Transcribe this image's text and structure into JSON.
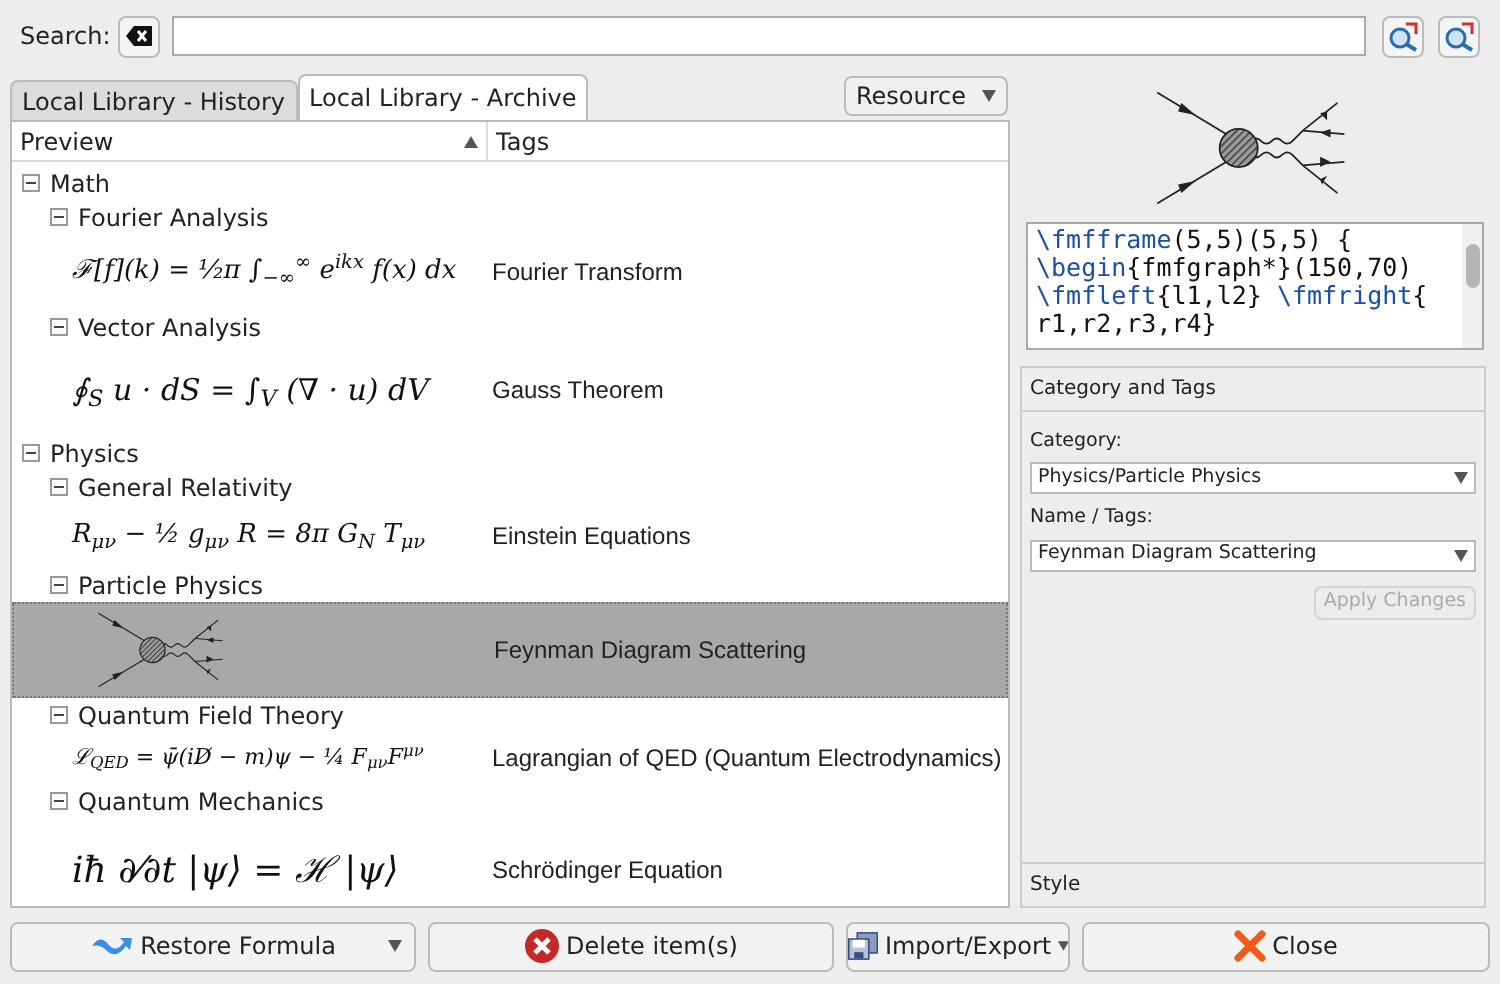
{
  "search": {
    "label": "Search:"
  },
  "tabs": [
    {
      "label": "Local Library - History",
      "selected": false
    },
    {
      "label": "Local Library - Archive",
      "selected": true
    }
  ],
  "resource_button": "Resource",
  "table": {
    "columns": [
      {
        "label": "Preview",
        "sorted": true
      },
      {
        "label": "Tags",
        "sorted": false
      }
    ],
    "tree": [
      {
        "label": "Math",
        "expanded": true,
        "children": [
          {
            "label": "Fourier Analysis",
            "expanded": true,
            "children": [
              {
                "kind": "formula",
                "formula": "ℱ[f](k) = ¹⁄₂π ∫$_{−∞}$$^{∞}$ e$^{ikx}$ f(x) dx",
                "tags": "Fourier Transform",
                "selected": false
              }
            ]
          },
          {
            "label": "Vector Analysis",
            "expanded": true,
            "children": [
              {
                "kind": "formula",
                "formula": "∮$_{S}$ u · dS = ∫$_{V}$ (∇ · u) dV",
                "tags": "Gauss Theorem",
                "selected": false
              }
            ]
          }
        ]
      },
      {
        "label": "Physics",
        "expanded": true,
        "children": [
          {
            "label": "General Relativity",
            "expanded": true,
            "children": [
              {
                "kind": "formula",
                "formula": "R$_{μν}$ − ½ g$_{μν}$ R = 8π G$_{N}$ T$_{μν}$",
                "tags": "Einstein Equations",
                "selected": false
              }
            ]
          },
          {
            "label": "Particle Physics",
            "expanded": true,
            "children": [
              {
                "kind": "diagram",
                "tags": "Feynman Diagram Scattering",
                "selected": true
              }
            ]
          },
          {
            "label": "Quantum Field Theory",
            "expanded": true,
            "children": [
              {
                "kind": "formula",
                "formula": "ℒ$_{QED}$ = ψ̄(iD̸ − m)ψ − ¼ F$_{μν}$F$^{μν}$",
                "tags": "Lagrangian of QED (Quantum Electrodynamics)",
                "selected": false
              }
            ]
          },
          {
            "label": "Quantum Mechanics",
            "expanded": true,
            "children": [
              {
                "kind": "formula",
                "formula": "iħ ∂⁄∂t |ψ⟩ = ℋ |ψ⟩",
                "tags": "Schrödinger Equation",
                "selected": false
              }
            ]
          }
        ]
      }
    ]
  },
  "preview": {
    "code": [
      [
        {
          "kind": "command",
          "text": "\\fmfframe"
        },
        {
          "kind": "plain",
          "text": "(5,5)(5,5) {"
        }
      ],
      [
        {
          "kind": "command",
          "text": "\\begin"
        },
        {
          "kind": "plain",
          "text": "{fmfgraph*}(150,70)"
        }
      ],
      [
        {
          "kind": "command",
          "text": "\\fmfleft"
        },
        {
          "kind": "plain",
          "text": "{l1,l2} "
        },
        {
          "kind": "command",
          "text": "\\fmfright"
        },
        {
          "kind": "plain",
          "text": "{"
        }
      ],
      [
        {
          "kind": "plain",
          "text": "r1,r2,r3,r4}"
        }
      ]
    ]
  },
  "category_and_tags": {
    "title": "Category and Tags",
    "category_label": "Category:",
    "category_value": "Physics/Particle Physics",
    "name_label": "Name / Tags:",
    "name_value": "Feynman Diagram Scattering",
    "apply_button": {
      "label": "Apply Changes",
      "disabled": true
    }
  },
  "style_section": "Style",
  "buttons": [
    {
      "kind": "restore",
      "label": "Restore Formula",
      "dropdown": true
    },
    {
      "kind": "delete",
      "label": "Delete item(s)",
      "dropdown": false
    },
    {
      "kind": "import",
      "label": "Import/Export",
      "dropdown": true
    },
    {
      "kind": "close",
      "label": "Close",
      "dropdown": false
    }
  ]
}
